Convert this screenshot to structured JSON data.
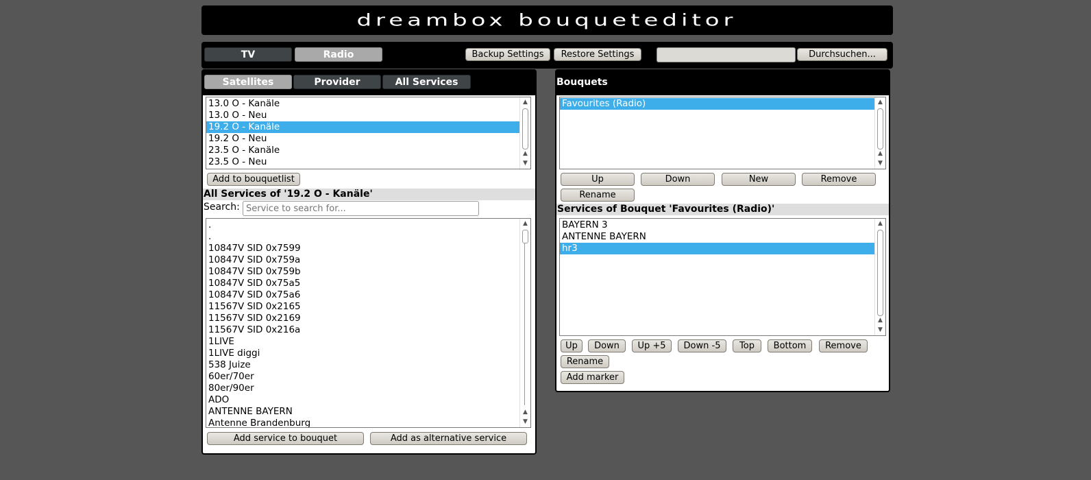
{
  "app": {
    "title": "dreambox bouqueteditor"
  },
  "toolbar": {
    "tabs": [
      {
        "label": "TV",
        "active": false
      },
      {
        "label": "Radio",
        "active": true
      }
    ],
    "backup_label": "Backup Settings",
    "restore_label": "Restore Settings",
    "file_input_value": "",
    "browse_label": "Durchsuchen..."
  },
  "left": {
    "tabs": [
      {
        "label": "Satellites",
        "active": true
      },
      {
        "label": "Provider",
        "active": false
      },
      {
        "label": "All Services",
        "active": false
      }
    ],
    "satellites": [
      {
        "label": "13.0 O - Kanäle",
        "selected": false
      },
      {
        "label": "13.0 O - Neu",
        "selected": false
      },
      {
        "label": "19.2 O - Kanäle",
        "selected": true
      },
      {
        "label": "19.2 O - Neu",
        "selected": false
      },
      {
        "label": "23.5 O - Kanäle",
        "selected": false
      },
      {
        "label": "23.5 O - Neu",
        "selected": false
      }
    ],
    "add_to_bouquetlist_label": "Add to bouquetlist",
    "services_title": "All Services of '19.2 O - Kanäle'",
    "search_label": "Search:",
    "search_placeholder": "Service to search for...",
    "services": [
      ".",
      ".",
      "10847V SID 0x7599",
      "10847V SID 0x759a",
      "10847V SID 0x759b",
      "10847V SID 0x75a5",
      "10847V SID 0x75a6",
      "11567V SID 0x2165",
      "11567V SID 0x2169",
      "11567V SID 0x216a",
      "1LIVE",
      "1LIVE diggi",
      "538 Juize",
      "60er/70er",
      "80er/90er",
      "ADO",
      "ANTENNE BAYERN",
      "Antenne Brandenburg"
    ],
    "add_service_label": "Add service to bouquet",
    "add_alternative_label": "Add as alternative service"
  },
  "right": {
    "title": "Bouquets",
    "bouquets": [
      {
        "label": "Favourites (Radio)",
        "selected": true
      }
    ],
    "bouquet_buttons": {
      "up": "Up",
      "down": "Down",
      "new": "New",
      "remove": "Remove",
      "rename": "Rename"
    },
    "services_title": "Services of Bouquet 'Favourites (Radio)'",
    "bouquet_services": [
      {
        "label": "BAYERN 3",
        "selected": false
      },
      {
        "label": "ANTENNE BAYERN",
        "selected": false
      },
      {
        "label": "hr3",
        "selected": true
      }
    ],
    "service_buttons": {
      "up": "Up",
      "down": "Down",
      "up5": "Up +5",
      "down5": "Down -5",
      "top": "Top",
      "bottom": "Bottom",
      "remove": "Remove",
      "rename": "Rename",
      "add_marker": "Add marker"
    }
  },
  "colors": {
    "background": "#565656",
    "selection": "#3daee9",
    "active_tab": "#a9a9a9",
    "inactive_tab": "#3f4447"
  }
}
